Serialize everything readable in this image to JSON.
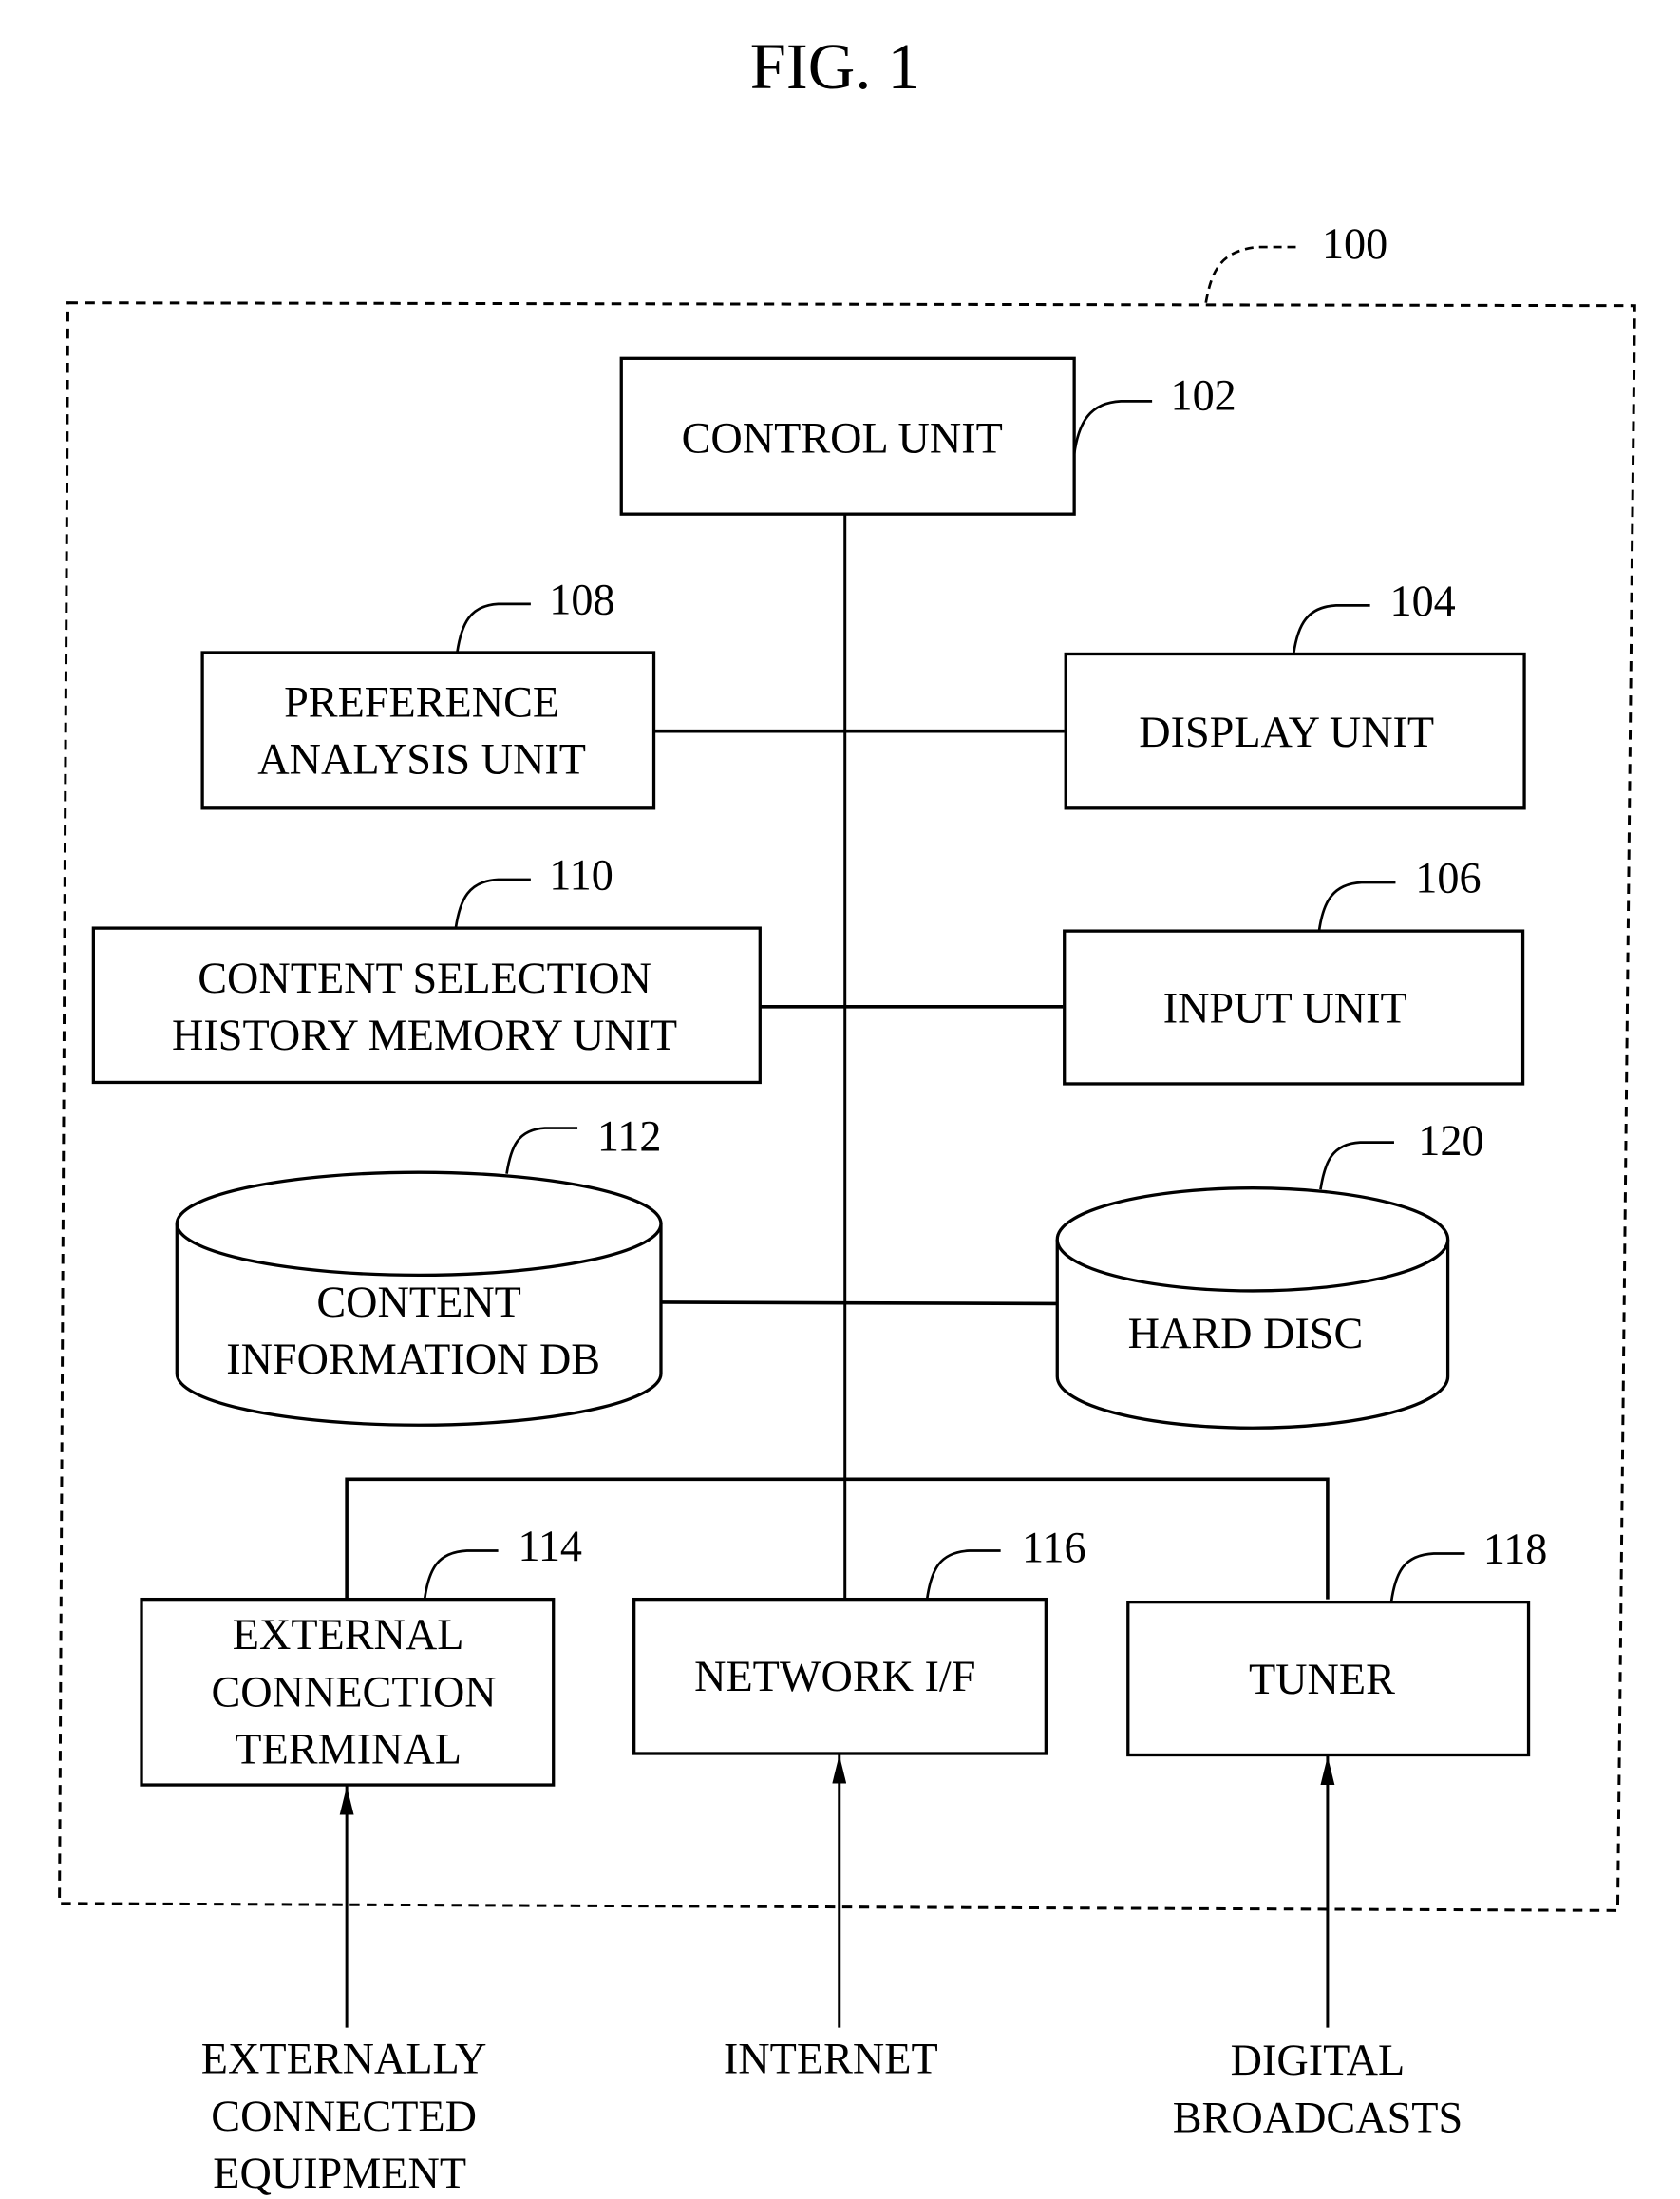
{
  "figure": {
    "title": "FIG. 1",
    "system_ref": "100"
  },
  "blocks": {
    "control_unit": {
      "ref": "102",
      "lines": [
        "CONTROL UNIT"
      ]
    },
    "display_unit": {
      "ref": "104",
      "lines": [
        "DISPLAY UNIT"
      ]
    },
    "input_unit": {
      "ref": "106",
      "lines": [
        "INPUT UNIT"
      ]
    },
    "preference_analysis_unit": {
      "ref": "108",
      "lines": [
        "PREFERENCE",
        "ANALYSIS UNIT"
      ]
    },
    "content_selection_history_memory_unit": {
      "ref": "110",
      "lines": [
        "CONTENT SELECTION",
        "HISTORY MEMORY UNIT"
      ]
    },
    "content_information_db": {
      "ref": "112",
      "lines": [
        "CONTENT",
        "INFORMATION DB"
      ]
    },
    "external_connection_terminal": {
      "ref": "114",
      "lines": [
        "EXTERNAL",
        "CONNECTION",
        "TERMINAL"
      ]
    },
    "network_if": {
      "ref": "116",
      "lines": [
        "NETWORK I/F"
      ]
    },
    "tuner": {
      "ref": "118",
      "lines": [
        "TUNER"
      ]
    },
    "hard_disc": {
      "ref": "120",
      "lines": [
        "HARD DISC"
      ]
    }
  },
  "inputs": {
    "externally_connected_equipment": [
      "EXTERNALLY",
      "CONNECTED",
      "EQUIPMENT"
    ],
    "internet": [
      "INTERNET"
    ],
    "digital_broadcasts": [
      "DIGITAL",
      "BROADCASTS"
    ]
  }
}
